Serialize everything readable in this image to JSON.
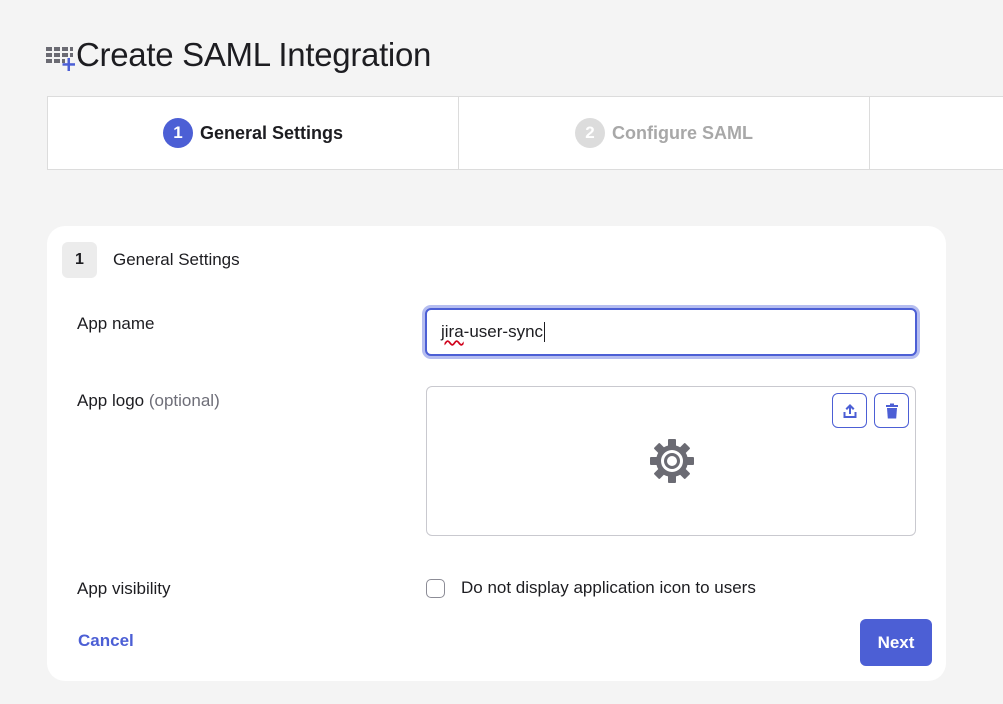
{
  "header": {
    "icon": "add-app-grid-icon",
    "title": "Create SAML Integration"
  },
  "stepper": {
    "steps": [
      {
        "number": "1",
        "label": "General Settings",
        "state": "active"
      },
      {
        "number": "2",
        "label": "Configure SAML",
        "state": "inactive"
      }
    ]
  },
  "form": {
    "section_number": "1",
    "section_title": "General Settings",
    "app_name": {
      "label": "App name",
      "value_misspelled": "jira",
      "value_rest": "-user-sync"
    },
    "app_logo": {
      "label": "App logo",
      "optional": "(optional)",
      "placeholder_icon": "gear-icon",
      "upload_icon": "upload-icon",
      "delete_icon": "trash-icon"
    },
    "app_visibility": {
      "label": "App visibility",
      "checkbox_label": "Do not display application icon to users",
      "checked": false
    },
    "cancel_label": "Cancel",
    "next_label": "Next"
  },
  "colors": {
    "accent": "#4c5fd5",
    "background": "#f4f4f4",
    "inactive": "#a8a8a8"
  }
}
